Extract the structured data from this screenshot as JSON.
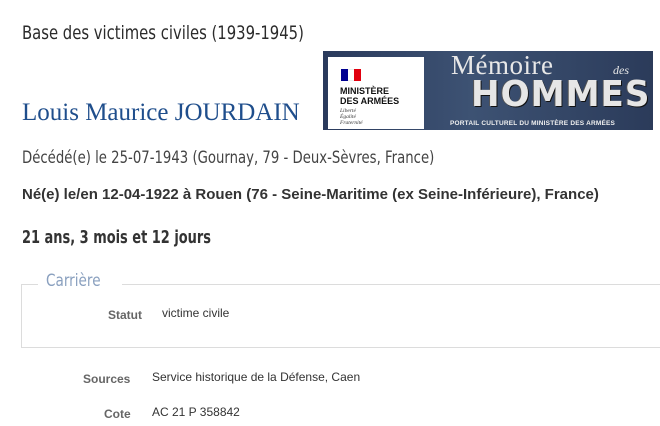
{
  "page": {
    "database_title": "Base des victimes civiles (1939-1945)",
    "person_name": "Louis Maurice JOURDAIN",
    "death_line": "Décédé(e) le 25-07-1943 (Gournay, 79 - Deux-Sèvres, France)",
    "birth_line": "Né(e) le/en 12-04-1922 à Rouen (76 - Seine-Maritime (ex Seine-Inférieure), France)",
    "age_line": "21 ans, 3 mois et 12 jours"
  },
  "banner": {
    "ministere_line1": "MINISTÈRE",
    "ministere_line2": "DES ARMÉES",
    "devise_line1": "Liberté",
    "devise_line2": "Égalité",
    "devise_line3": "Fraternité",
    "memoire": "Mémoire",
    "des": "des",
    "hommes": "HOMMES",
    "portail": "PORTAIL CULTUREL DU MINISTÈRE DES ARMÉES",
    "flag_colors": [
      "#000091",
      "#ffffff",
      "#e1000f"
    ]
  },
  "carriere": {
    "legend": "Carrière",
    "statut_label": "Statut",
    "statut_value": "victime civile"
  },
  "sources": {
    "label": "Sources",
    "value": "Service historique de la Défense, Caen"
  },
  "cote": {
    "label": "Cote",
    "value": "AC 21 P 358842"
  }
}
